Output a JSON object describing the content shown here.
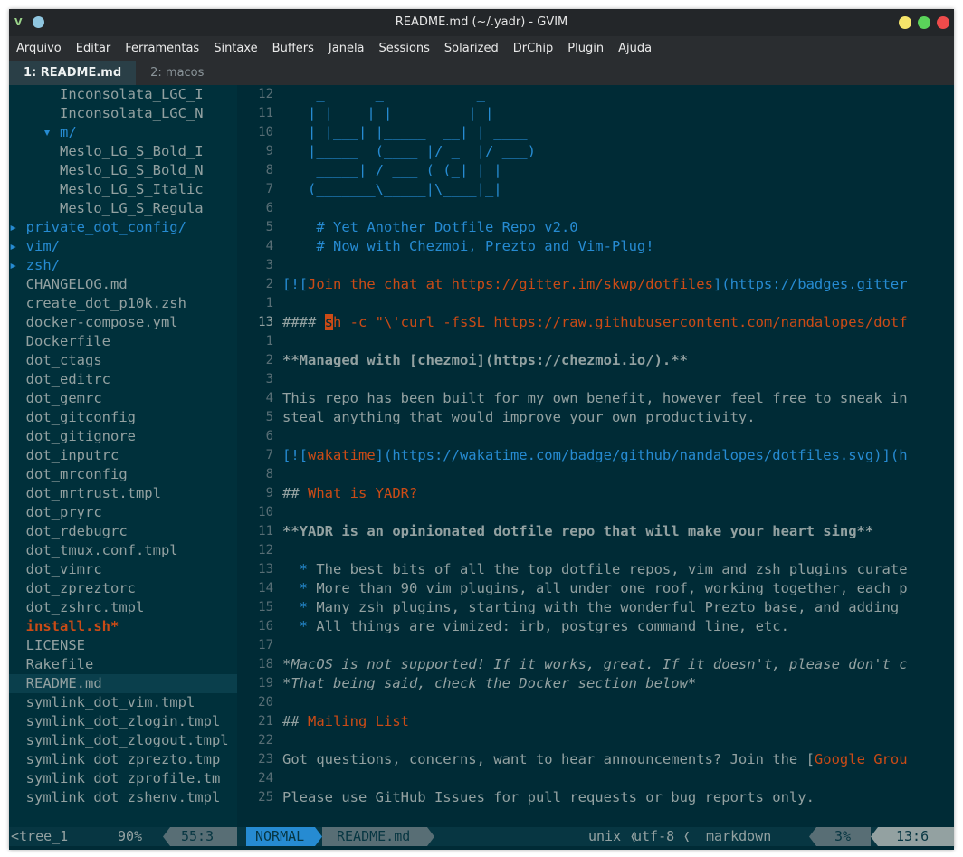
{
  "window": {
    "title": "README.md (~/.yadr) - GVIM"
  },
  "menu": [
    "Arquivo",
    "Editar",
    "Ferramentas",
    "Sintaxe",
    "Buffers",
    "Janela",
    "Sessions",
    "Solarized",
    "DrChip",
    "Plugin",
    "Ajuda"
  ],
  "tabs": [
    {
      "label": "1: README.md",
      "active": true
    },
    {
      "label": "2: macos",
      "active": false
    }
  ],
  "tree": [
    {
      "text": "      Inconsolata_LGC_I",
      "kind": "file"
    },
    {
      "text": "      Inconsolata_LGC_N",
      "kind": "file"
    },
    {
      "text": "    ▾ m/",
      "kind": "dir"
    },
    {
      "text": "      Meslo_LG_S_Bold_I",
      "kind": "file"
    },
    {
      "text": "      Meslo_LG_S_Bold_N",
      "kind": "file"
    },
    {
      "text": "      Meslo_LG_S_Italic",
      "kind": "file"
    },
    {
      "text": "      Meslo_LG_S_Regula",
      "kind": "file"
    },
    {
      "text": "▸ private_dot_config/",
      "kind": "dir"
    },
    {
      "text": "▸ vim/",
      "kind": "dir"
    },
    {
      "text": "▸ zsh/",
      "kind": "dir"
    },
    {
      "text": "  CHANGELOG.md",
      "kind": "file"
    },
    {
      "text": "  create_dot_p10k.zsh",
      "kind": "file"
    },
    {
      "text": "  docker-compose.yml",
      "kind": "file"
    },
    {
      "text": "  Dockerfile",
      "kind": "file"
    },
    {
      "text": "  dot_ctags",
      "kind": "file"
    },
    {
      "text": "  dot_editrc",
      "kind": "file"
    },
    {
      "text": "  dot_gemrc",
      "kind": "file"
    },
    {
      "text": "  dot_gitconfig",
      "kind": "file"
    },
    {
      "text": "  dot_gitignore",
      "kind": "file"
    },
    {
      "text": "  dot_inputrc",
      "kind": "file"
    },
    {
      "text": "  dot_mrconfig",
      "kind": "file"
    },
    {
      "text": "  dot_mrtrust.tmpl",
      "kind": "file"
    },
    {
      "text": "  dot_pryrc",
      "kind": "file"
    },
    {
      "text": "  dot_rdebugrc",
      "kind": "file"
    },
    {
      "text": "  dot_tmux.conf.tmpl",
      "kind": "file"
    },
    {
      "text": "  dot_vimrc",
      "kind": "file"
    },
    {
      "text": "  dot_zpreztorc",
      "kind": "file"
    },
    {
      "text": "  dot_zshrc.tmpl",
      "kind": "file"
    },
    {
      "text": "  install.sh*",
      "kind": "exec"
    },
    {
      "text": "  LICENSE",
      "kind": "file"
    },
    {
      "text": "  Rakefile",
      "kind": "file"
    },
    {
      "text": "  README.md",
      "kind": "selected"
    },
    {
      "text": "  symlink_dot_vim.tmpl",
      "kind": "file"
    },
    {
      "text": "  symlink_dot_zlogin.tmpl",
      "kind": "file"
    },
    {
      "text": "  symlink_dot_zlogout.tmpl",
      "kind": "file"
    },
    {
      "text": "  symlink_dot_zprezto.tmp",
      "kind": "file"
    },
    {
      "text": "  symlink_dot_zprofile.tm",
      "kind": "file"
    },
    {
      "text": "  symlink_dot_zshenv.tmpl",
      "kind": "file"
    }
  ],
  "lines": [
    {
      "n": "12",
      "cur": false,
      "parts": [
        [
          "    _      _           _",
          "blue"
        ]
      ]
    },
    {
      "n": "11",
      "cur": false,
      "parts": [
        [
          "   | |    | |         | |",
          "blue"
        ]
      ]
    },
    {
      "n": "10",
      "cur": false,
      "parts": [
        [
          "   | |___| |_____  __| | ____",
          "blue"
        ]
      ]
    },
    {
      "n": "9",
      "cur": false,
      "parts": [
        [
          "   |_____  (____ |/ _  |/ ___)",
          "blue"
        ]
      ]
    },
    {
      "n": "8",
      "cur": false,
      "parts": [
        [
          "    _____| / ___ ( (_| | |",
          "blue"
        ]
      ]
    },
    {
      "n": "7",
      "cur": false,
      "parts": [
        [
          "   (_______\\_____|\\____|_|",
          "blue"
        ]
      ]
    },
    {
      "n": "6",
      "cur": false,
      "parts": [
        [
          "",
          ""
        ]
      ]
    },
    {
      "n": "5",
      "cur": false,
      "parts": [
        [
          "    # Yet Another Dotfile Repo v2.0",
          "blue"
        ]
      ]
    },
    {
      "n": "4",
      "cur": false,
      "parts": [
        [
          "    # Now with Chezmoi, Prezto and Vim-Plug!",
          "blue"
        ]
      ]
    },
    {
      "n": "3",
      "cur": false,
      "parts": [
        [
          "",
          ""
        ]
      ]
    },
    {
      "n": "2",
      "cur": false,
      "parts": [
        [
          "[![",
          "blue"
        ],
        [
          "Join the chat at https://gitter.im/skwp/dotfiles",
          "orange"
        ],
        [
          "](https://badges.gitter",
          "blue"
        ]
      ]
    },
    {
      "n": "1",
      "cur": false,
      "parts": [
        [
          "",
          ""
        ]
      ]
    },
    {
      "n": "13",
      "cur": true,
      "parts": [
        [
          "#### ",
          "plain"
        ],
        [
          "s",
          "cursor"
        ],
        [
          "h -c \"\\'curl -fsSL https://raw.githubusercontent.com/nandalopes/dotf",
          "orange"
        ]
      ]
    },
    {
      "n": "1",
      "cur": false,
      "parts": [
        [
          "",
          ""
        ]
      ]
    },
    {
      "n": "2",
      "cur": false,
      "parts": [
        [
          "**Managed with [chezmoi](https://chezmoi.io/).**",
          "bold"
        ]
      ]
    },
    {
      "n": "3",
      "cur": false,
      "parts": [
        [
          "",
          ""
        ]
      ]
    },
    {
      "n": "4",
      "cur": false,
      "parts": [
        [
          "This repo has been built for my own benefit, however feel free to sneak in",
          "plain"
        ]
      ]
    },
    {
      "n": "5",
      "cur": false,
      "parts": [
        [
          "steal anything that would improve your own productivity.",
          "plain"
        ]
      ]
    },
    {
      "n": "6",
      "cur": false,
      "parts": [
        [
          "",
          ""
        ]
      ]
    },
    {
      "n": "7",
      "cur": false,
      "parts": [
        [
          "[![",
          "blue"
        ],
        [
          "wakatime",
          "orange"
        ],
        [
          "](https://wakatime.com/badge/github/nandalopes/dotfiles.svg)](h",
          "blue"
        ]
      ]
    },
    {
      "n": "8",
      "cur": false,
      "parts": [
        [
          "",
          ""
        ]
      ]
    },
    {
      "n": "9",
      "cur": false,
      "parts": [
        [
          "## ",
          "plain"
        ],
        [
          "What is YADR?",
          "orange"
        ]
      ]
    },
    {
      "n": "10",
      "cur": false,
      "parts": [
        [
          "",
          ""
        ]
      ]
    },
    {
      "n": "11",
      "cur": false,
      "parts": [
        [
          "**YADR is an opinionated dotfile repo that will make your heart sing**",
          "bold"
        ]
      ]
    },
    {
      "n": "12",
      "cur": false,
      "parts": [
        [
          "",
          ""
        ]
      ]
    },
    {
      "n": "13",
      "cur": false,
      "parts": [
        [
          "  * ",
          "blue"
        ],
        [
          "The best bits of all the top dotfile repos, vim and zsh plugins curate",
          "plain"
        ]
      ]
    },
    {
      "n": "14",
      "cur": false,
      "parts": [
        [
          "  * ",
          "blue"
        ],
        [
          "More than 90 vim plugins, all under one roof, working together, each p",
          "plain"
        ]
      ]
    },
    {
      "n": "15",
      "cur": false,
      "parts": [
        [
          "  * ",
          "blue"
        ],
        [
          "Many zsh plugins, starting with the wonderful Prezto base, and adding",
          "plain"
        ]
      ]
    },
    {
      "n": "16",
      "cur": false,
      "parts": [
        [
          "  * ",
          "blue"
        ],
        [
          "All things are vimized: irb, postgres command line, etc.",
          "plain"
        ]
      ]
    },
    {
      "n": "17",
      "cur": false,
      "parts": [
        [
          "",
          ""
        ]
      ]
    },
    {
      "n": "18",
      "cur": false,
      "parts": [
        [
          "*MacOS is not supported! If it works, great. If it doesn't, please don't c",
          "ital"
        ]
      ]
    },
    {
      "n": "19",
      "cur": false,
      "parts": [
        [
          "*That being said, check the Docker section below*",
          "ital"
        ]
      ]
    },
    {
      "n": "20",
      "cur": false,
      "parts": [
        [
          "",
          ""
        ]
      ]
    },
    {
      "n": "21",
      "cur": false,
      "parts": [
        [
          "## ",
          "plain"
        ],
        [
          "Mailing List",
          "orange"
        ]
      ]
    },
    {
      "n": "22",
      "cur": false,
      "parts": [
        [
          "",
          ""
        ]
      ]
    },
    {
      "n": "23",
      "cur": false,
      "parts": [
        [
          "Got questions, concerns, want to hear announcements? Join the [",
          "plain"
        ],
        [
          "Google Grou",
          "orange"
        ]
      ]
    },
    {
      "n": "24",
      "cur": false,
      "parts": [
        [
          "",
          ""
        ]
      ]
    },
    {
      "n": "25",
      "cur": false,
      "parts": [
        [
          "Please use GitHub Issues for pull requests or bug reports only.",
          "plain"
        ]
      ]
    }
  ],
  "status": {
    "tree_name": "<tree_1",
    "tree_pct": "90%",
    "tree_pos": "55:3",
    "mode": "NORMAL",
    "file": "README.md",
    "fileformat": "unix",
    "sep": "❬",
    "encoding": "utf-8",
    "filetype": "markdown",
    "pct": "3%",
    "pos": "13:6"
  },
  "colors": {
    "background": "#002b36",
    "blue": "#268bd2",
    "orange": "#cb4b16",
    "text": "#93a1a1",
    "linenr": "#586e75"
  }
}
